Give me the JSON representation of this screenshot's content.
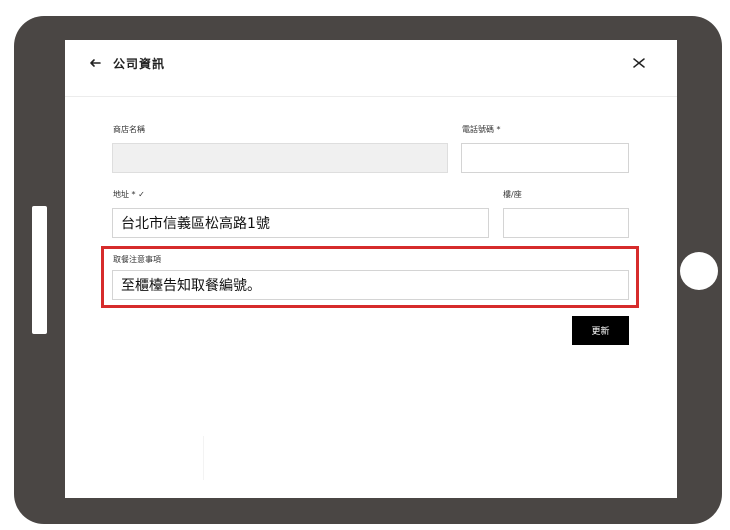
{
  "header": {
    "title": "公司資訊",
    "back_icon": "arrow-left-icon",
    "close_icon": "close-icon"
  },
  "form": {
    "store_name": {
      "label": "商店名稱",
      "value": ""
    },
    "phone": {
      "label": "電話號碼 *",
      "value": ""
    },
    "address": {
      "label": "地址 * ✓",
      "value": "台北市信義區松高路1號"
    },
    "floor": {
      "label": "樓/座",
      "value": ""
    },
    "pickup_notes": {
      "label": "取餐注意事項",
      "value": "至櫃檯告知取餐編號。"
    }
  },
  "actions": {
    "update_label": "更新"
  },
  "colors": {
    "frame": "#4a4644",
    "highlight": "#d62b2b",
    "button": "#000000"
  }
}
